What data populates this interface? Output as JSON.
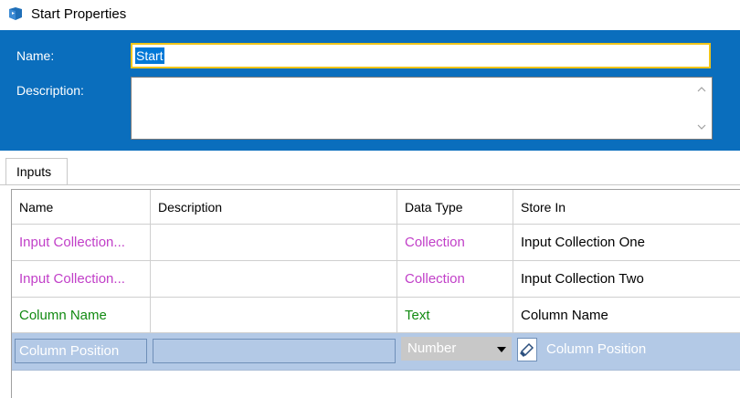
{
  "window": {
    "title": "Start Properties",
    "icon": "start-stage-icon"
  },
  "header": {
    "name_label": "Name:",
    "name_value": "Start",
    "description_label": "Description:",
    "description_value": ""
  },
  "tabs": [
    {
      "label": "Inputs"
    }
  ],
  "grid": {
    "columns": [
      "Name",
      "Description",
      "Data Type",
      "Store In"
    ],
    "rows": [
      {
        "name": "Input Collection...",
        "description": "",
        "data_type": "Collection",
        "store_in": "Input Collection One"
      },
      {
        "name": "Input Collection...",
        "description": "",
        "data_type": "Collection",
        "store_in": "Input Collection Two"
      },
      {
        "name": "Column Name",
        "description": "",
        "data_type": "Text",
        "store_in": "Column Name"
      }
    ],
    "editing_row": {
      "name": "Column Position",
      "description": "",
      "data_type": "Number",
      "store_in": "Column Position"
    }
  },
  "colors": {
    "header_bg": "#0a6ebd",
    "collection": "#c13fc8",
    "text_type": "#128a12",
    "selected_row": "#b3c9e6",
    "focus_border": "#f0c419"
  }
}
